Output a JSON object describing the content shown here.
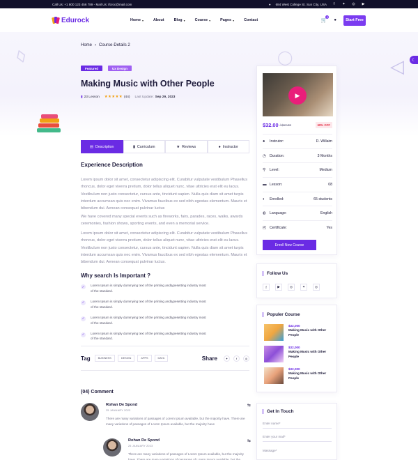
{
  "topbar": {
    "contact": "Call Us: +1 800 123 456 789 - Mail Us: ifcroc@mail.com",
    "address": "684 West College St. Sun City, USA",
    "socials": [
      "facebook-icon",
      "twitter-icon",
      "instagram-icon",
      "youtube-icon"
    ]
  },
  "nav": {
    "logo": "Edurock",
    "items": [
      {
        "label": "Home",
        "dropdown": true
      },
      {
        "label": "About",
        "dropdown": false
      },
      {
        "label": "Blog",
        "dropdown": true
      },
      {
        "label": "Course",
        "dropdown": true
      },
      {
        "label": "Pages",
        "dropdown": true
      },
      {
        "label": "Contact",
        "dropdown": false
      }
    ],
    "cart_count": "0",
    "start_label": "Start Free"
  },
  "hero": {
    "breadcrumb_home": "Home",
    "breadcrumb_current": "Course-Details 2",
    "badge_featured": "Featured",
    "badge_category": "Ux Design",
    "title": "Making Music with Other People",
    "lessons": "23 Lesson",
    "reviews": "(44)",
    "rating": 5,
    "last_update_label": "Last Update:",
    "last_update": "Sep 29, 2023"
  },
  "tabs": [
    {
      "label": "Description",
      "icon": "description-icon",
      "active": true
    },
    {
      "label": "Curriculum",
      "icon": "book-icon",
      "active": false
    },
    {
      "label": "Reviews",
      "icon": "star-icon",
      "active": false
    },
    {
      "label": "Instructor",
      "icon": "user-icon",
      "active": false
    }
  ],
  "description": {
    "heading": "Experience Description",
    "p1": "Lorem ipsum dolor sit amet, consectetur adipiscing elit. Curabitur vulputate vestibulum Phasellus rhoncus, dolor eget viverra pretium, dolor tellus aliquet nunc, vitae ultricies erat elit eu lacus. Vestibulum non justo consectetur, cursus ante, tincidunt sapien. Nulla quis diam sit amet turpis interdum accumsan quis nec enim. Vivamus faucibus ex sed nibh egestas elementum. Mauris et bibendum dui. Aenean consequat pulvinar luctus",
    "p2": "We have covered many special events such as fireworks, fairs, parades, races, walks, awards ceremonies, fashion shows, sporting events, and even a memorial service.",
    "p3": "Lorem ipsum dolor sit amet, consectetur adipiscing elit. Curabitur vulputate vestibulum Phasellus rhoncus, dolor eget viverra pretium, dolor tellus aliquet nunc, vitae ultricies erat elit eu lacus. Vestibulum non justo consectetur, cursus ante, tincidunt sapien. Nulla quis diam sit amet turpis interdum accumsan quis nec enim. Vivamus faucibus ex sed nibh egestas elementum. Mauris et bibendum dui. Aenean consequat pulvinar luctus.",
    "important_heading": "Why search Is Important ?",
    "checklist": [
      "Lorem Ipsum is simply dummying text of the printing andtypesetting industry most of the standard.",
      "Lorem Ipsum is simply dummying text of the printing andtypesetting industry most of the standard.",
      "Lorem Ipsum is simply dummying text of the printing andtypesetting industry most of the standard.",
      "Lorem Ipsum is simply dummying text of the printing andtypesetting industry most of the standard."
    ]
  },
  "tags": {
    "label": "Tag",
    "items": [
      "BUSINESS",
      "DESIGN",
      "APPS",
      "DATA"
    ],
    "share_label": "Share",
    "share_icons": [
      "twitter-icon",
      "facebook-icon",
      "instagram-icon"
    ]
  },
  "comments": {
    "heading": "(04) Comment",
    "items": [
      {
        "name": "Rohan De Spond",
        "date": "25 JANUARY 2023",
        "text": "There are many variations of passages of Lorem Ipsum available, but the majority have. There are many variations of passages of Lorem Ipsum available, but the majority have"
      },
      {
        "name": "Rohan De Spond",
        "date": "25 JANUARY 2023",
        "text": "There are many variations of passages of Lorem Ipsum available, but the majority have. There are many variations of passages of Lorem Ipsum available, but the majority have"
      }
    ]
  },
  "course_card": {
    "price": "$32.00",
    "old_price": "/ $67.00",
    "discount": "68% OFF",
    "info": [
      {
        "label": "Instrutor:",
        "value": "D. Willaim",
        "icon": "user-icon"
      },
      {
        "label": "Duration:",
        "value": "3 Months",
        "icon": "clock-icon"
      },
      {
        "label": "Level:",
        "value": "Medium",
        "icon": "level-icon"
      },
      {
        "label": "Lesson:",
        "value": "08",
        "icon": "lesson-icon"
      },
      {
        "label": "Enrolled:",
        "value": "65 students",
        "icon": "enrolled-icon"
      },
      {
        "label": "Language:",
        "value": "English",
        "icon": "globe-icon"
      },
      {
        "label": "Certificate:",
        "value": "Yes",
        "icon": "certificate-icon"
      }
    ],
    "enroll_label": "Enroll Now Course"
  },
  "follow": {
    "title": "Follow Us",
    "icons": [
      "facebook-icon",
      "youtube-icon",
      "instagram-icon",
      "twitter-icon",
      "instagram-icon"
    ]
  },
  "popular": {
    "title": "Populer Course",
    "items": [
      {
        "price": "$32,000",
        "name": "Making Music with Other People"
      },
      {
        "price": "$32,000",
        "name": "Making Music with Other People"
      },
      {
        "price": "$32,000",
        "name": "Making Music with Other People"
      }
    ]
  },
  "touch": {
    "title": "Get In Touch",
    "name_placeholder": "Enter name*",
    "email_placeholder": "Enter your mail*",
    "message_placeholder": "Massage*"
  },
  "colors": {
    "accent": "#6a2be4",
    "topbar": "#11102a",
    "star": "#f2a114",
    "discount": "#e63a4f"
  }
}
